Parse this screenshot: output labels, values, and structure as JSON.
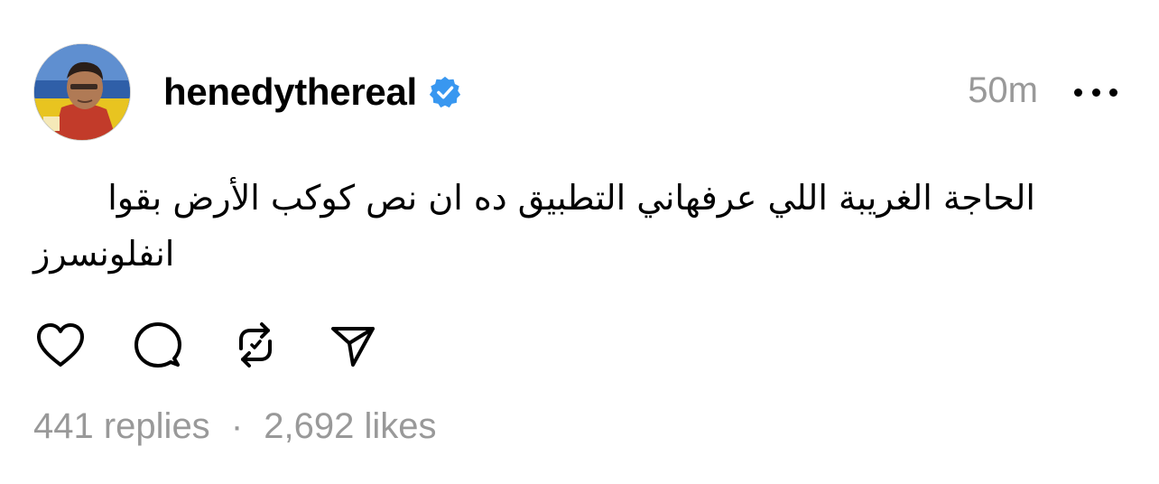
{
  "post": {
    "username": "henedythereal",
    "verified": true,
    "timestamp": "50m",
    "text_line1": "الحاجة الغريبة اللي عرفهاني التطبيق ده ان نص كوكب الأرض بقوا",
    "text_line2": "انفلونسرز",
    "replies": "441 replies",
    "separator": "·",
    "likes": "2,692 likes"
  },
  "icons": {
    "avatar": "profile-avatar",
    "verified": "verified-badge-icon",
    "more": "more-horizontal-icon",
    "like": "heart-icon",
    "reply": "comment-bubble-icon",
    "repost": "repost-icon",
    "share": "send-icon"
  },
  "colors": {
    "verified_badge": "#3897f0",
    "muted_text": "#999999",
    "text": "#000000",
    "background": "#ffffff"
  }
}
